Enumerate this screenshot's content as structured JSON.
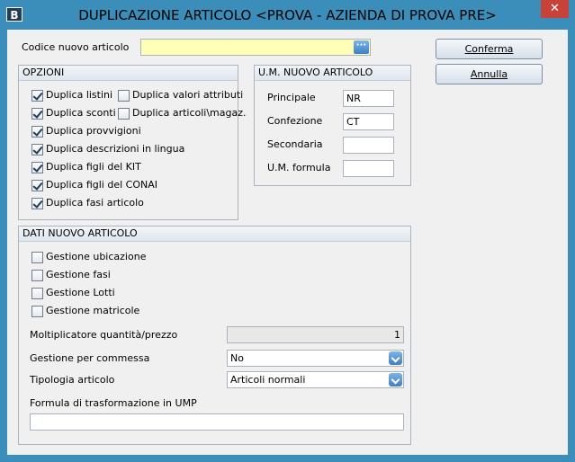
{
  "window": {
    "app_icon": "B",
    "title": "DUPLICAZIONE ARTICOLO <PROVA - AZIENDA DI PROVA PRE>",
    "close_label": "✕"
  },
  "codice": {
    "label": "Codice nuovo articolo",
    "value": "",
    "button_label": "···"
  },
  "buttons": {
    "conferma": "Conferma",
    "annulla": "Annulla"
  },
  "opzioni": {
    "header": "OPZIONI",
    "items_left": [
      {
        "label": "Duplica listini",
        "checked": true
      },
      {
        "label": "Duplica sconti",
        "checked": true
      },
      {
        "label": "Duplica provvigioni",
        "checked": true
      },
      {
        "label": "Duplica descrizioni in lingua",
        "checked": true
      },
      {
        "label": "Duplica figli del KIT",
        "checked": true
      },
      {
        "label": "Duplica figli del CONAI",
        "checked": true
      },
      {
        "label": "Duplica fasi articolo",
        "checked": true
      }
    ],
    "items_right": [
      {
        "label": "Duplica valori attributi",
        "checked": false
      },
      {
        "label": "Duplica articoli\\magaz.",
        "checked": false
      }
    ]
  },
  "um": {
    "header": "U.M. NUOVO ARTICOLO",
    "fields": [
      {
        "label": "Principale",
        "value": "NR"
      },
      {
        "label": "Confezione",
        "value": "CT"
      },
      {
        "label": "Secondaria",
        "value": ""
      },
      {
        "label": "U.M. formula",
        "value": ""
      }
    ]
  },
  "dati": {
    "header": "DATI NUOVO ARTICOLO",
    "checks": [
      {
        "label": "Gestione ubicazione",
        "checked": false
      },
      {
        "label": "Gestione fasi",
        "checked": false
      },
      {
        "label": "Gestione Lotti",
        "checked": false
      },
      {
        "label": "Gestione matricole",
        "checked": false
      }
    ],
    "moltiplicatore": {
      "label": "Moltiplicatore quantità/prezzo",
      "value": "1"
    },
    "gestione_commessa": {
      "label": "Gestione per commessa",
      "value": "No"
    },
    "tipologia": {
      "label": "Tipologia articolo",
      "value": "Articoli normali"
    },
    "formula": {
      "label": "Formula di trasformazione in UMP",
      "value": ""
    }
  }
}
